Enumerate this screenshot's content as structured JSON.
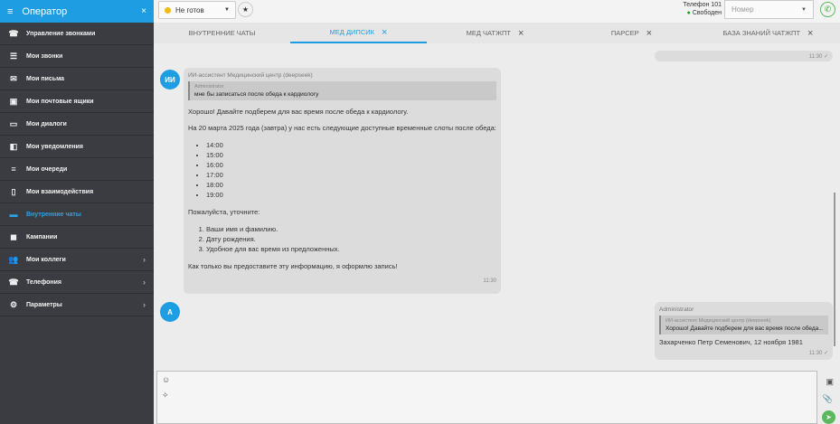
{
  "sidebar": {
    "title": "Оператор",
    "items": [
      {
        "label": "Управление звонками",
        "icon": "☎"
      },
      {
        "label": "Мои звонки",
        "icon": "☰"
      },
      {
        "label": "Мои письма",
        "icon": "✉"
      },
      {
        "label": "Мои почтовые ящики",
        "icon": "▣"
      },
      {
        "label": "Мои диалоги",
        "icon": "▭"
      },
      {
        "label": "Мои уведомления",
        "icon": "◧"
      },
      {
        "label": "Мои очереди",
        "icon": "≡"
      },
      {
        "label": "Мои взаимодействия",
        "icon": "▯"
      },
      {
        "label": "Внутренние чаты",
        "icon": "▬"
      },
      {
        "label": "Кампании",
        "icon": "◼"
      },
      {
        "label": "Мои коллеги",
        "icon": "👥"
      },
      {
        "label": "Телефония",
        "icon": "☎"
      },
      {
        "label": "Параметры",
        "icon": "⚙"
      }
    ]
  },
  "topbar": {
    "status": "Не готов",
    "phone_label": "Телефон 101",
    "phone_status": "Свободен",
    "number_placeholder": "Номер"
  },
  "tabs": [
    "ВНУТРЕННИЕ ЧАТЫ",
    "МЕД ДИПСИК",
    "МЕД ЧАТЖПТ",
    "ПАРСЕР",
    "БАЗА ЗНАНИЙ ЧАТЖПТ"
  ],
  "chat": {
    "top_time": "11:30",
    "ai": {
      "avatar": "ИИ",
      "sender": "ИИ-ассистент Медицинский центр (deepseek)",
      "quote_author": "Administrator",
      "quote_text": "мне бы записаться после обеда к кардиологу",
      "p1": "Хорошо! Давайте подберем для вас время после обеда к кардиологу.",
      "p2": "На 20 марта 2025 года (завтра) у нас есть следующие доступные временные слоты после обеда:",
      "slots": [
        "14:00",
        "15:00",
        "16:00",
        "17:00",
        "18:00",
        "19:00"
      ],
      "p3": "Пожалуйста, уточните:",
      "asks": [
        "Ваши имя и фамилию.",
        "Дату рождения.",
        "Удобное для вас время из предложенных."
      ],
      "p4": "Как только вы предоставите эту информацию, я оформлю запись!",
      "time": "11:30"
    },
    "user": {
      "avatar": "А",
      "sender": "Administrator",
      "quote_author": "ИИ-ассистент Медицинский центр (deepseek)",
      "quote_text": "Хорошо! Давайте подберем для вас время после обеда...",
      "text": "Захарченко Петр Семенович, 12 ноября 1981",
      "time": "11:30"
    }
  }
}
